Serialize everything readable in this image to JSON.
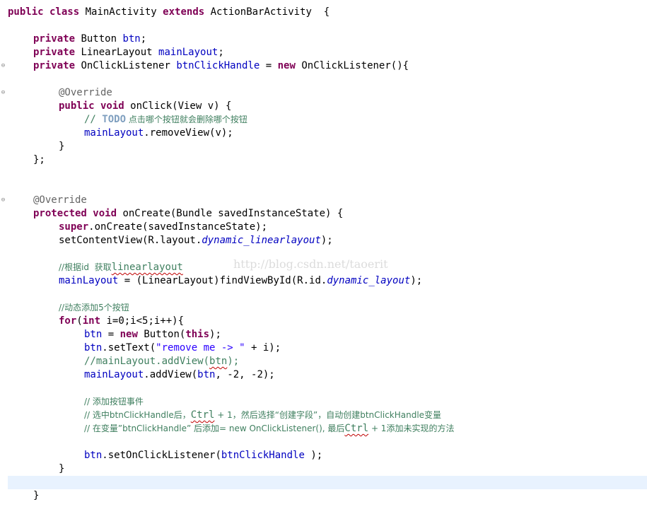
{
  "watermark": "http://blog.csdn.net/taoerit",
  "fold_marker": "⊖",
  "code": {
    "l1": {
      "a": "public class",
      "b": " MainActivity ",
      "c": "extends",
      "d": " ActionBarActivity  {"
    },
    "l3": {
      "a": "private",
      "b": " Button ",
      "c": "btn",
      "d": ";"
    },
    "l4": {
      "a": "private",
      "b": " LinearLayout ",
      "c": "mainLayout",
      "d": ";"
    },
    "l5": {
      "a": "private",
      "b": " OnClickListener ",
      "c": "btnClickHandle",
      "d": " = ",
      "e": "new",
      "f": " OnClickListener(){"
    },
    "l7": {
      "a": "@Override"
    },
    "l8": {
      "a": "public void",
      "b": " onClick(View v) {"
    },
    "l9": {
      "a": "// ",
      "b": "TODO",
      "c": " 点击哪个按钮就会删除哪个按钮"
    },
    "l10": {
      "a": "mainLayout",
      "b": ".removeView(v);"
    },
    "l11": {
      "a": "}"
    },
    "l12": {
      "a": "};"
    },
    "l15": {
      "a": "@Override"
    },
    "l16": {
      "a": "protected void",
      "b": " onCreate(Bundle savedInstanceState) {"
    },
    "l17": {
      "a": "super",
      "b": ".onCreate(savedInstanceState);"
    },
    "l18": {
      "a": "setContentView(R.layout.",
      "b": "dynamic_linearlayout",
      "c": ");"
    },
    "l20": {
      "a": "//根据id  获取",
      "b": "linearlayout"
    },
    "l21": {
      "a": "mainLayout",
      "b": " = (LinearLayout)findViewById(R.id.",
      "c": "dynamic_layout",
      "d": ");"
    },
    "l23": {
      "a": "//动态添加5个按钮"
    },
    "l24": {
      "a": "for",
      "b": "(",
      "c": "int",
      "d": " i=0;i<5;i++){"
    },
    "l25": {
      "a": "btn",
      "b": " = ",
      "c": "new",
      "d": " Button(",
      "e": "this",
      "f": ");"
    },
    "l26": {
      "a": "btn",
      "b": ".setText(",
      "c": "\"remove me -> \"",
      "d": " + i);"
    },
    "l27": {
      "a": "//mainLayout.addView(",
      "b": "btn",
      "c": ");"
    },
    "l28": {
      "a": "mainLayout",
      "b": ".addView(",
      "c": "btn",
      "d": ", -2, -2);"
    },
    "l30": {
      "a": "// 添加按钮事件"
    },
    "l31": {
      "a": "// 选中btnClickHandle后，",
      "b": "Ctrl",
      "c": " + 1，然后选择“创建字段”，自动创建btnClickHandle变量"
    },
    "l32": {
      "a": "// 在变量”btnClickHandle” 后添加= new OnClickListener(), 最后",
      "b": "Ctrl",
      "c": " + 1添加未实现的方法"
    },
    "l34": {
      "a": "btn",
      "b": ".setOnClickListener(",
      "c": "btnClickHandle",
      "d": " );"
    },
    "l35": {
      "a": "}"
    },
    "l37": {
      "a": "}"
    }
  }
}
